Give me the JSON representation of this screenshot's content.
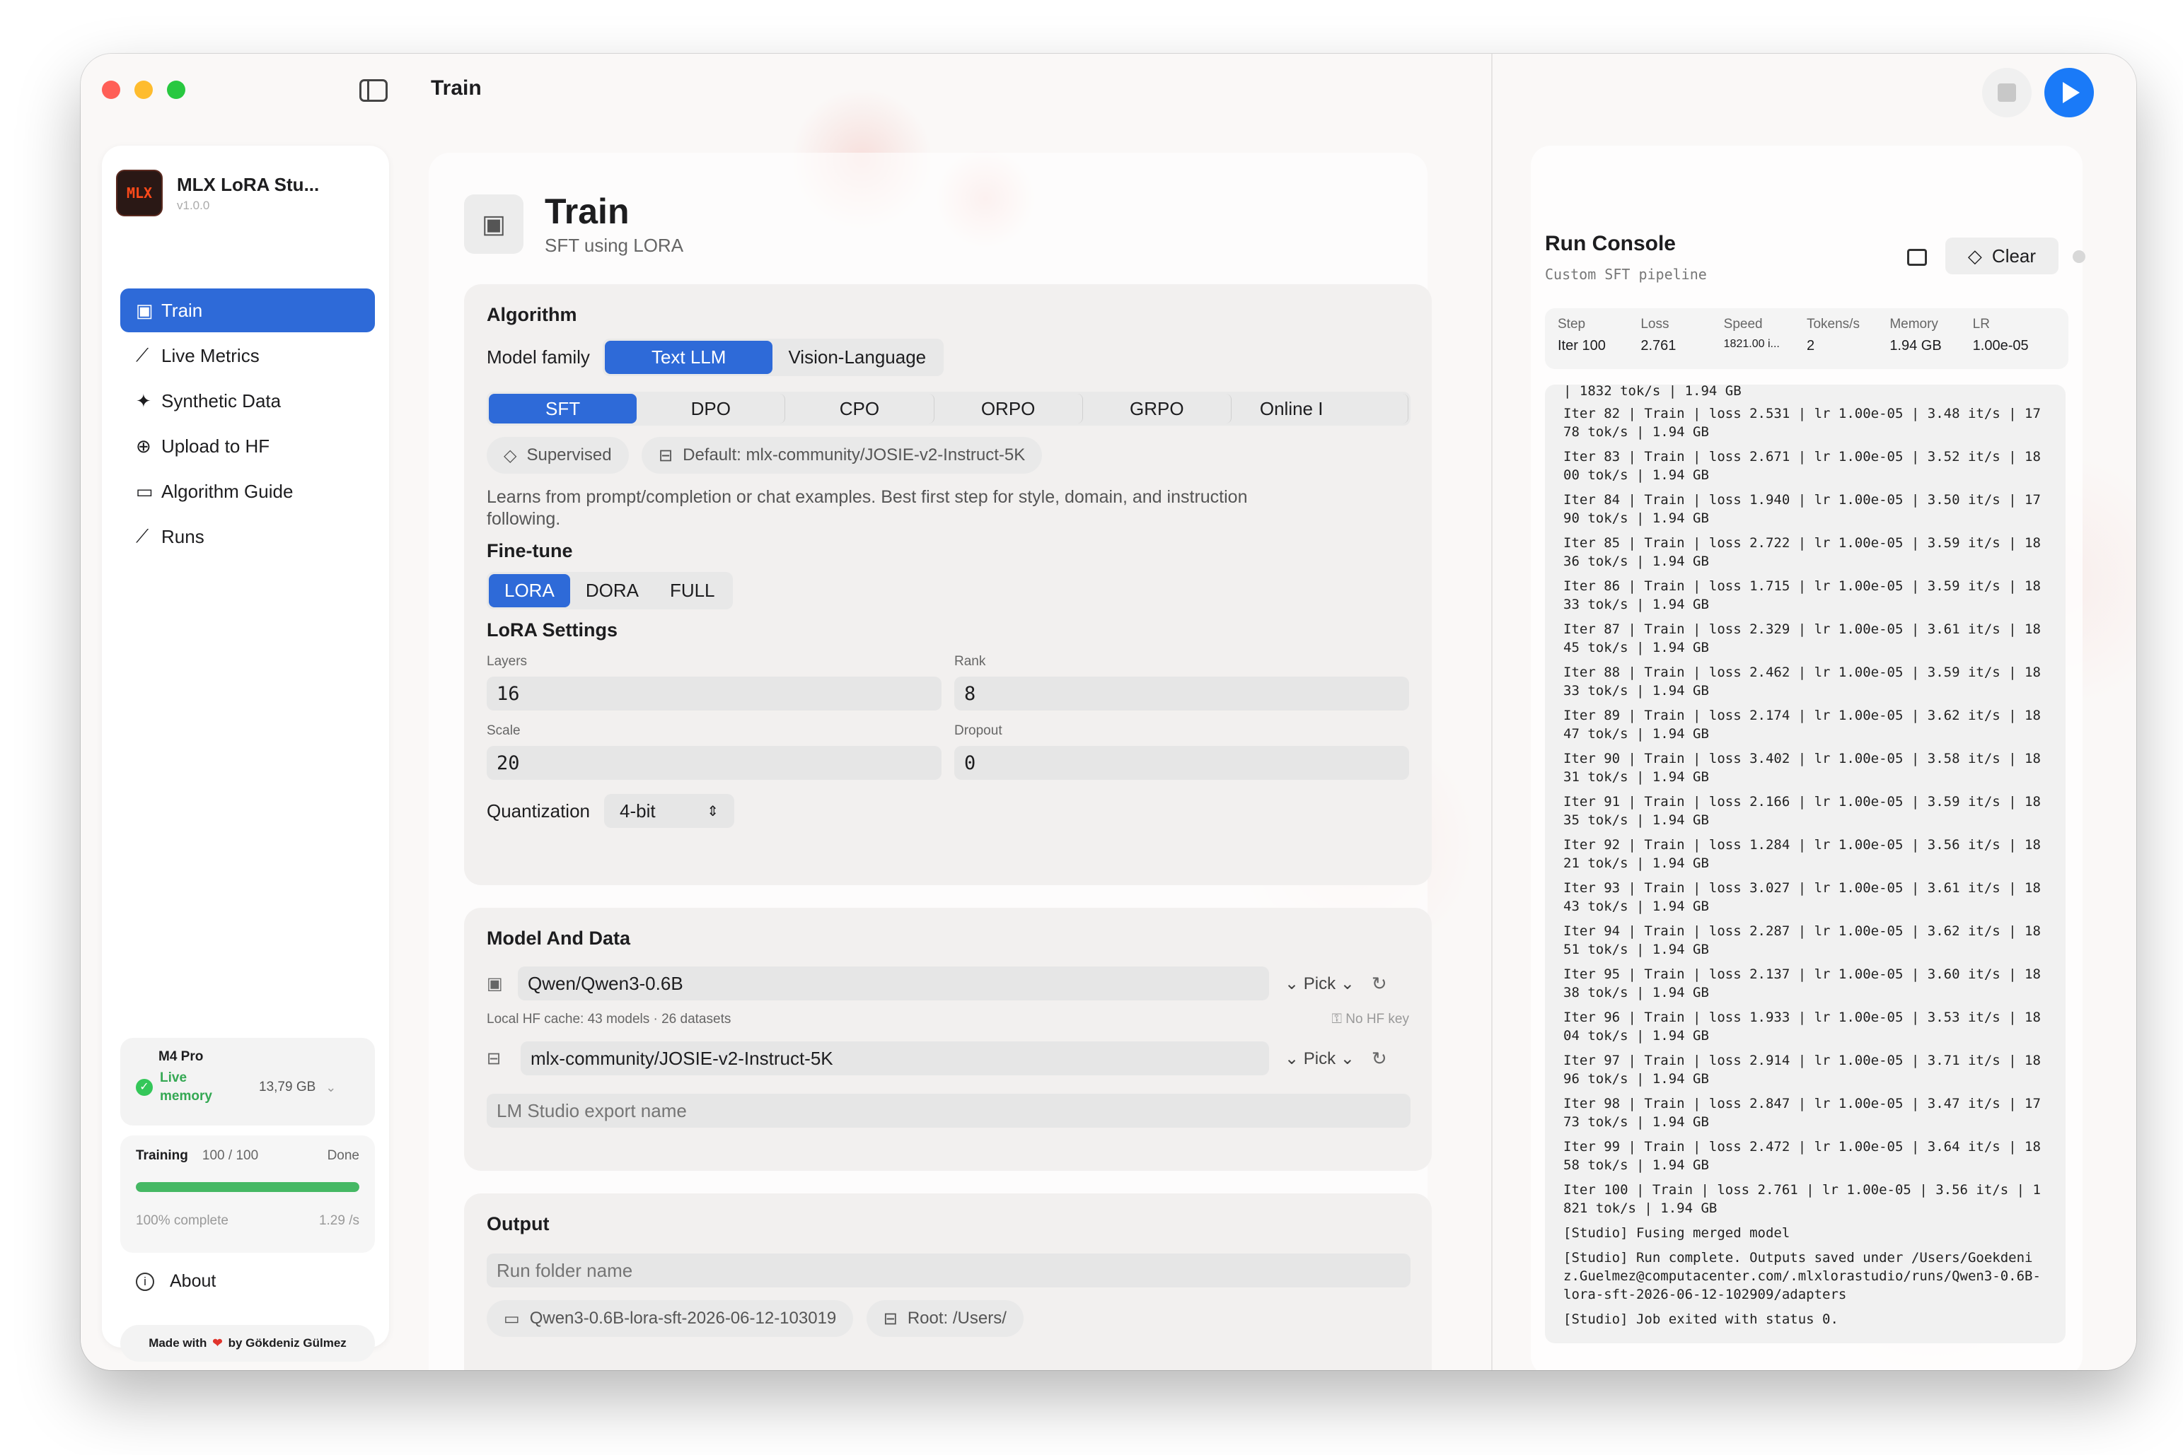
{
  "window_title": "Train",
  "app": {
    "name": "MLX LoRA Stu...",
    "version": "v1.0.0",
    "logo_text": "MLX"
  },
  "nav": [
    {
      "label": "Train",
      "icon": "chip-icon",
      "glyph": "▣"
    },
    {
      "label": "Live Metrics",
      "icon": "chart-line-icon",
      "glyph": "⟋"
    },
    {
      "label": "Synthetic Data",
      "icon": "sparkles-icon",
      "glyph": "✦"
    },
    {
      "label": "Upload to HF",
      "icon": "upload-circle-icon",
      "glyph": "⊕"
    },
    {
      "label": "Algorithm Guide",
      "icon": "book-icon",
      "glyph": "▭"
    },
    {
      "label": "Runs",
      "icon": "chart-runs-icon",
      "glyph": "⟋"
    }
  ],
  "system": {
    "chip": "M4 Pro",
    "status": "Live memory",
    "memory": "13,79 GB"
  },
  "training": {
    "label": "Training",
    "count": "100 / 100",
    "state": "Done",
    "progress": 1.0,
    "complete": "100% complete",
    "rate": "1.29 /s"
  },
  "about_label": "About",
  "made_with": {
    "pre": "Made with",
    "post": "by Gökdeniz Gülmez"
  },
  "header": {
    "title": "Train",
    "subtitle": "SFT using LORA"
  },
  "algorithm": {
    "title": "Algorithm",
    "model_family_label": "Model family",
    "families": [
      "Text LLM",
      "Vision-Language"
    ],
    "algorithms": [
      "SFT",
      "DPO",
      "CPO",
      "ORPO",
      "GRPO",
      "Online I"
    ],
    "tag_supervised": "Supervised",
    "tag_default": "Default: mlx-community/JOSIE-v2-Instruct-5K",
    "description": "Learns from prompt/completion or chat examples. Best first step for style, domain, and instruction following.",
    "finetune_title": "Fine-tune",
    "finetune_modes": [
      "LORA",
      "DORA",
      "FULL"
    ],
    "lora_title": "LoRA Settings",
    "layers_label": "Layers",
    "layers": "16",
    "rank_label": "Rank",
    "rank": "8",
    "scale_label": "Scale",
    "scale": "20",
    "dropout_label": "Dropout",
    "dropout": "0",
    "quant_label": "Quantization",
    "quant": "4-bit"
  },
  "model_data": {
    "title": "Model And Data",
    "model": "Qwen/Qwen3-0.6B",
    "pick": "Pick",
    "cache_info": "Local HF cache: 43 models · 26 datasets",
    "hf_key": "No HF key",
    "dataset": "mlx-community/JOSIE-v2-Instruct-5K",
    "export_placeholder": "LM Studio export name"
  },
  "output": {
    "title": "Output",
    "folder_placeholder": "Run folder name",
    "folder": "Qwen3-0.6B-lora-sft-2026-06-12-103019",
    "root": "Root: /Users/"
  },
  "console": {
    "title": "Run Console",
    "subtitle": "Custom SFT pipeline",
    "clear": "Clear",
    "metrics": [
      {
        "k": "Step",
        "v": "Iter 100"
      },
      {
        "k": "Loss",
        "v": "2.761"
      },
      {
        "k": "Speed",
        "v": "1821.00 i..."
      },
      {
        "k": "Tokens/s",
        "v": "2"
      },
      {
        "k": "Memory",
        "v": "1.94 GB"
      },
      {
        "k": "LR",
        "v": "1.00e-05"
      }
    ],
    "log_top": "| 1832 tok/s | 1.94 GB",
    "log": [
      "Iter 82 | Train | loss 2.531 | lr 1.00e-05 | 3.48 it/s | 1778 tok/s | 1.94 GB",
      "Iter 83 | Train | loss 2.671 | lr 1.00e-05 | 3.52 it/s | 1800 tok/s | 1.94 GB",
      "Iter 84 | Train | loss 1.940 | lr 1.00e-05 | 3.50 it/s | 1790 tok/s | 1.94 GB",
      "Iter 85 | Train | loss 2.722 | lr 1.00e-05 | 3.59 it/s | 1836 tok/s | 1.94 GB",
      "Iter 86 | Train | loss 1.715 | lr 1.00e-05 | 3.59 it/s | 1833 tok/s | 1.94 GB",
      "Iter 87 | Train | loss 2.329 | lr 1.00e-05 | 3.61 it/s | 1845 tok/s | 1.94 GB",
      "Iter 88 | Train | loss 2.462 | lr 1.00e-05 | 3.59 it/s | 1833 tok/s | 1.94 GB",
      "Iter 89 | Train | loss 2.174 | lr 1.00e-05 | 3.62 it/s | 1847 tok/s | 1.94 GB",
      "Iter 90 | Train | loss 3.402 | lr 1.00e-05 | 3.58 it/s | 1831 tok/s | 1.94 GB",
      "Iter 91 | Train | loss 2.166 | lr 1.00e-05 | 3.59 it/s | 1835 tok/s | 1.94 GB",
      "Iter 92 | Train | loss 1.284 | lr 1.00e-05 | 3.56 it/s | 1821 tok/s | 1.94 GB",
      "Iter 93 | Train | loss 3.027 | lr 1.00e-05 | 3.61 it/s | 1843 tok/s | 1.94 GB",
      "Iter 94 | Train | loss 2.287 | lr 1.00e-05 | 3.62 it/s | 1851 tok/s | 1.94 GB",
      "Iter 95 | Train | loss 2.137 | lr 1.00e-05 | 3.60 it/s | 1838 tok/s | 1.94 GB",
      "Iter 96 | Train | loss 1.933 | lr 1.00e-05 | 3.53 it/s | 1804 tok/s | 1.94 GB",
      "Iter 97 | Train | loss 2.914 | lr 1.00e-05 | 3.71 it/s | 1896 tok/s | 1.94 GB",
      "Iter 98 | Train | loss 2.847 | lr 1.00e-05 | 3.47 it/s | 1773 tok/s | 1.94 GB",
      "Iter 99 | Train | loss 2.472 | lr 1.00e-05 | 3.64 it/s | 1858 tok/s | 1.94 GB",
      "Iter 100 | Train | loss 2.761 | lr 1.00e-05 | 3.56 it/s | 1821 tok/s | 1.94 GB",
      "[Studio] Fusing merged model",
      "[Studio] Run complete. Outputs saved under /Users/Goekdeniz.Guelmez@computacenter.com/.mlxlorastudio/runs/Qwen3-0.6B-lora-sft-2026-06-12-102909/adapters",
      "[Studio] Job exited with status 0."
    ]
  },
  "colors": {
    "accent": "#2e6ad8",
    "success": "#45b864",
    "play": "#1a7af8",
    "close": "#ff5f57",
    "minimize": "#febc2e",
    "zoom": "#28c840"
  }
}
